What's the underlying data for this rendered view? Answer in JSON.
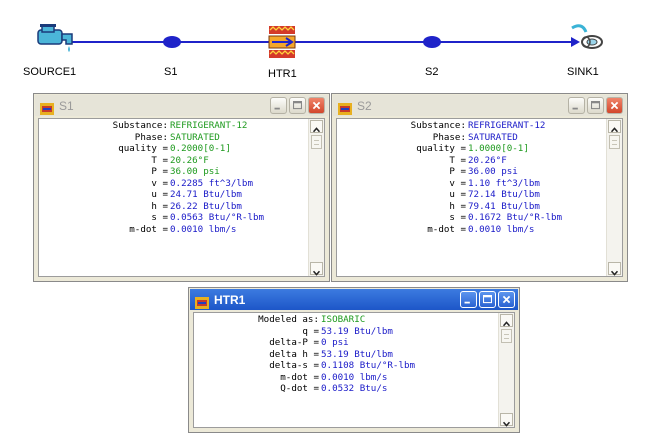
{
  "flow": {
    "nodes": [
      {
        "label": "SOURCE1"
      },
      {
        "label": "S1"
      },
      {
        "label": "HTR1"
      },
      {
        "label": "S2"
      },
      {
        "label": "SINK1"
      }
    ],
    "line_color": "#1f23c9"
  },
  "windows": {
    "s1": {
      "title": "S1",
      "rows": [
        {
          "label": "Substance:",
          "value": "REFRIGERANT-12",
          "color": "green"
        },
        {
          "label": "Phase:",
          "value": "SATURATED",
          "color": "green"
        },
        {
          "label": "quality =",
          "value": "0.2000[0-1]",
          "color": "green"
        },
        {
          "label": "T =",
          "value": "20.26°F",
          "color": "green"
        },
        {
          "label": "P =",
          "value": "36.00 psi",
          "color": "green"
        },
        {
          "label": "v =",
          "value": "0.2285 ft^3/lbm",
          "color": "blue"
        },
        {
          "label": "u =",
          "value": "24.71 Btu/lbm",
          "color": "blue"
        },
        {
          "label": "h =",
          "value": "26.22 Btu/lbm",
          "color": "blue"
        },
        {
          "label": "s =",
          "value": "0.0563 Btu/°R-lbm",
          "color": "blue"
        },
        {
          "label": "m-dot =",
          "value": "0.0010 lbm/s",
          "color": "blue"
        }
      ]
    },
    "s2": {
      "title": "S2",
      "rows": [
        {
          "label": "Substance:",
          "value": "REFRIGERANT-12",
          "color": "blue"
        },
        {
          "label": "Phase:",
          "value": "SATURATED",
          "color": "blue"
        },
        {
          "label": "quality =",
          "value": "1.0000[0-1]",
          "color": "green"
        },
        {
          "label": "T =",
          "value": "20.26°F",
          "color": "blue"
        },
        {
          "label": "P =",
          "value": "36.00 psi",
          "color": "blue"
        },
        {
          "label": "v =",
          "value": "1.10 ft^3/lbm",
          "color": "blue"
        },
        {
          "label": "u =",
          "value": "72.14 Btu/lbm",
          "color": "blue"
        },
        {
          "label": "h =",
          "value": "79.41 Btu/lbm",
          "color": "blue"
        },
        {
          "label": "s =",
          "value": "0.1672 Btu/°R-lbm",
          "color": "blue"
        },
        {
          "label": "m-dot =",
          "value": "0.0010 lbm/s",
          "color": "blue"
        }
      ]
    },
    "htr1": {
      "title": "HTR1",
      "rows": [
        {
          "label": "Modeled as:",
          "value": "ISOBARIC",
          "color": "green"
        },
        {
          "label": "q =",
          "value": "53.19 Btu/lbm",
          "color": "blue"
        },
        {
          "label": "delta-P =",
          "value": "0 psi",
          "color": "blue"
        },
        {
          "label": "delta h =",
          "value": "53.19 Btu/lbm",
          "color": "blue"
        },
        {
          "label": "delta-s =",
          "value": "0.1108 Btu/°R-lbm",
          "color": "blue"
        },
        {
          "label": "m-dot =",
          "value": "0.0010 lbm/s",
          "color": "blue"
        },
        {
          "label": "Q-dot =",
          "value": "0.0532 Btu/s",
          "color": "blue"
        }
      ]
    }
  }
}
